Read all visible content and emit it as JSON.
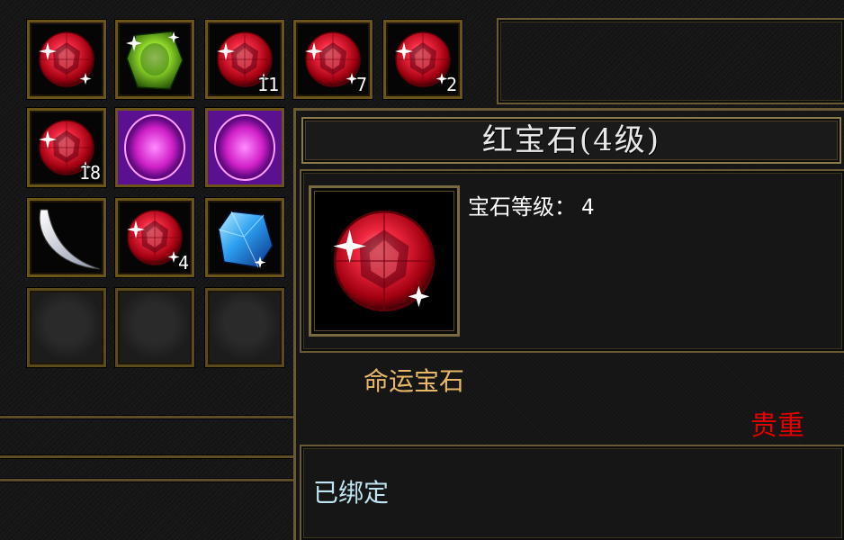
{
  "inventory": {
    "slots": [
      {
        "item": "red-gem-icon",
        "count": ""
      },
      {
        "item": "green-gem-icon",
        "count": ""
      },
      {
        "item": "red-gem-icon",
        "count": "11"
      },
      {
        "item": "red-gem-icon",
        "count": "7"
      },
      {
        "item": "red-gem-icon",
        "count": "2"
      },
      {
        "item": "red-gem-icon",
        "count": "18"
      },
      {
        "item": "purple-orb-icon",
        "count": ""
      },
      {
        "item": "purple-orb-icon",
        "count": ""
      },
      {
        "item": "white-crescent-icon",
        "count": ""
      },
      {
        "item": "red-gem-icon",
        "count": "4"
      },
      {
        "item": "blue-gem-icon",
        "count": ""
      }
    ]
  },
  "tooltip": {
    "title": "红宝石(4级)",
    "gem_level_label": "宝石等级：",
    "gem_level_value": "4",
    "category": "命运宝石",
    "rarity": "贵重",
    "binding": "已绑定"
  },
  "colors": {
    "category": "#e8b868",
    "rarity": "#e60000",
    "binding": "#bfe3f0",
    "frame_gold": "#6b5418"
  }
}
